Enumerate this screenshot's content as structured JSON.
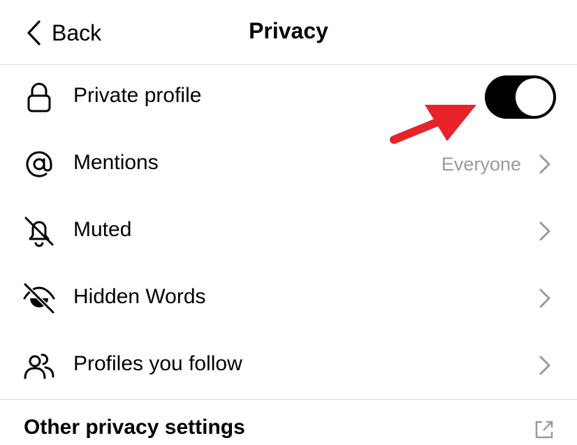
{
  "header": {
    "back_label": "Back",
    "title": "Privacy"
  },
  "rows": [
    {
      "label": "Private profile",
      "icon": "lock-icon",
      "toggle_on": true
    },
    {
      "label": "Mentions",
      "icon": "at-sign-icon",
      "value": "Everyone"
    },
    {
      "label": "Muted",
      "icon": "bell-off-icon"
    },
    {
      "label": "Hidden Words",
      "icon": "eye-off-icon"
    },
    {
      "label": "Profiles you follow",
      "icon": "people-icon"
    }
  ],
  "section": {
    "title": "Other privacy settings",
    "icon": "external-link-icon"
  },
  "colors": {
    "accent": "#000000",
    "annotation_arrow": "#e8232a",
    "secondary_text": "#9a9a9a",
    "divider": "#d9d9d9"
  }
}
